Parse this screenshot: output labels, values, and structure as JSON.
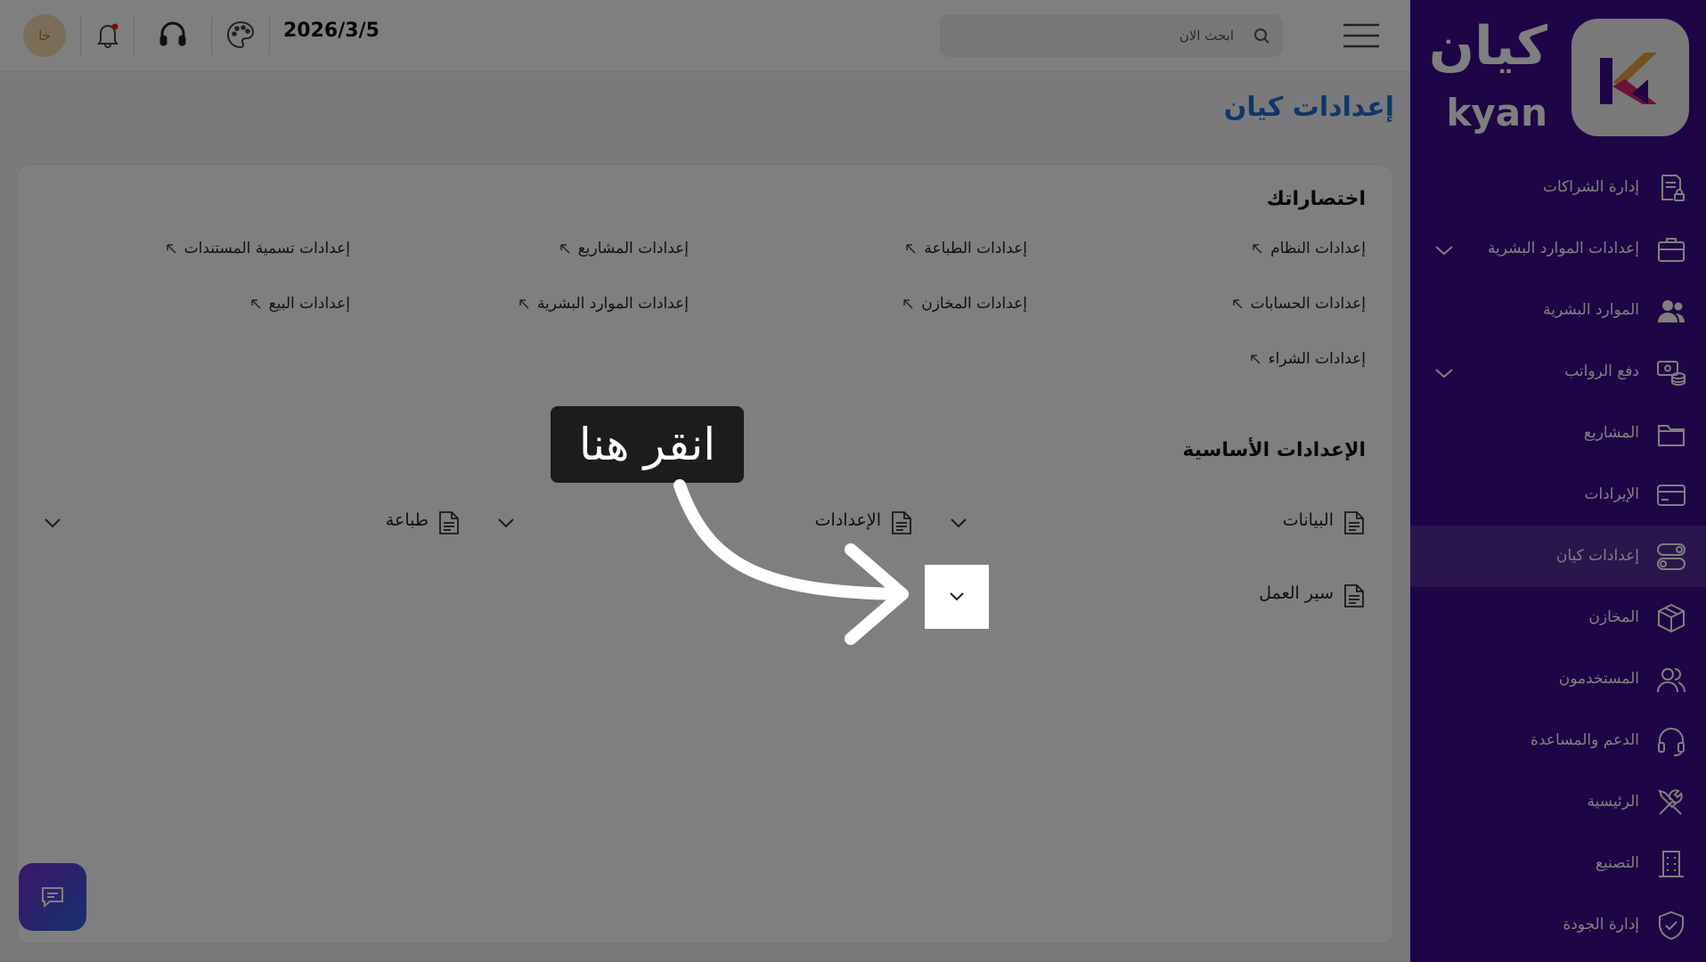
{
  "brand": {
    "name_ar": "كيان",
    "name_en": "kyan"
  },
  "header": {
    "search_placeholder": "ابحث الان",
    "date": "2026/3/5",
    "avatar_initials": "خا"
  },
  "sidebar": {
    "items": [
      {
        "label": "إدارة الشراكات",
        "icon": "document-lock-icon"
      },
      {
        "label": "إعدادات الموارد البشرية",
        "icon": "briefcase-icon",
        "expandable": true
      },
      {
        "label": "الموارد البشرية",
        "icon": "people-icon"
      },
      {
        "label": "دفع الرواتب",
        "icon": "cash-coins-icon",
        "expandable": true
      },
      {
        "label": "المشاريع",
        "icon": "folder-icon"
      },
      {
        "label": "الإيرادات",
        "icon": "card-icon"
      },
      {
        "label": "إعدادات كيان",
        "icon": "toggles-icon",
        "active": true
      },
      {
        "label": "المخازن",
        "icon": "box-icon"
      },
      {
        "label": "المستخدمون",
        "icon": "users-icon"
      },
      {
        "label": "الدعم والمساعدة",
        "icon": "headset-icon"
      },
      {
        "label": "الرئيسية",
        "icon": "tools-icon"
      },
      {
        "label": "التصنيع",
        "icon": "building-icon"
      },
      {
        "label": "إدارة الجودة",
        "icon": "shield-check-icon"
      }
    ]
  },
  "page": {
    "title": "إعدادات كيان",
    "shortcuts_title": "اختصاراتك",
    "shortcuts": [
      "إعدادات النظام",
      "إعدادات الطباعة",
      "إعدادات المشاريع",
      "إعدادات تسمية المستندات",
      "إعدادات الحسابات",
      "إعدادات المخازن",
      "إعدادات الموارد البشرية",
      "إعدادات البيع",
      "إعدادات الشراء"
    ],
    "basic_title": "الإعدادات الأساسية",
    "basic_items": [
      "البيانات",
      "الإعدادات",
      "طباعة",
      "سير العمل"
    ]
  },
  "tutorial": {
    "tip_text": "انقر هنا"
  },
  "colors": {
    "sidebar": "#3d0b8c",
    "title": "#1e6fd0",
    "overlay": "rgba(0,0,0,0.5)"
  }
}
